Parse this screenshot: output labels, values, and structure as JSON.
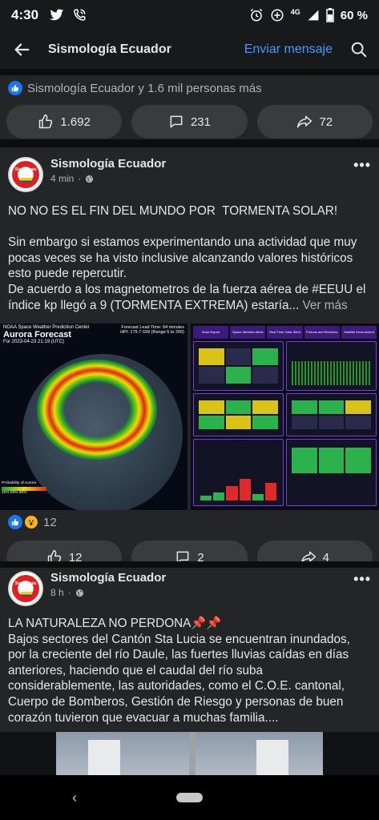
{
  "status_bar": {
    "time": "4:30",
    "network": "4G",
    "battery": "60 %"
  },
  "header": {
    "title": "Sismología Ecuador",
    "send_message": "Enviar mensaje"
  },
  "top_card": {
    "reactions_text": "Sismología Ecuador y 1.6 mil personas más",
    "likes": "1.692",
    "comments": "231",
    "shares": "72"
  },
  "posts": [
    {
      "author": "Sismología Ecuador",
      "time": "4 min",
      "text": "NO NO ES EL FIN DEL MUNDO POR  TORMENTA SOLAR!\n\nSin embargo si estamos experimentando una actividad que muy pocas veces se ha visto inclusive alcanzando valores históricos esto puede repercutir.\nDe acuerdo a los magnetometros de la fuerza aérea de #EEUU el índice kp llegó a 9 (TORMENTA EXTREMA) estaría...",
      "see_more": " Ver más",
      "image_left": {
        "header_small": "NOAA Space Weather Prediction Center",
        "title": "Aurora Forecast",
        "forecast_for": "For 2023-04-23 21:19 (UTC)",
        "lead_time": "Forecast Lead Time: 64 minutes",
        "hpi": "HPI: 179.7 GW (Range 5 to 200)",
        "legend_title": "Probability of Aurora",
        "legend_ticks": "10%        50%        90%"
      },
      "image_right": {
        "tabs": [
          "Solar Report",
          "Space Weather Alerts",
          "Real Time Solar Wind",
          "Protons and Electrons",
          "Satellite Environment"
        ]
      },
      "reaction_count": "12",
      "likes": "12",
      "comments": "2",
      "shares": "4"
    },
    {
      "author": "Sismología Ecuador",
      "time": "8 h",
      "text": "LA NATURALEZA NO PERDONA📌📌\nBajos sectores del Cantón Sta Lucia se encuentran inundados, por la creciente del río Daule, las fuertes lluvias caídas en días anteriores, haciendo que el caudal del río suba considerablemente, las autoridades, como el C.O.E. cantonal, Cuerpo de Bomberos, Gestión de Riesgo y personas de buen corazón tuvieron que evacuar a muchas familia...."
    }
  ],
  "avatar_text": "Sismología Ecuador"
}
